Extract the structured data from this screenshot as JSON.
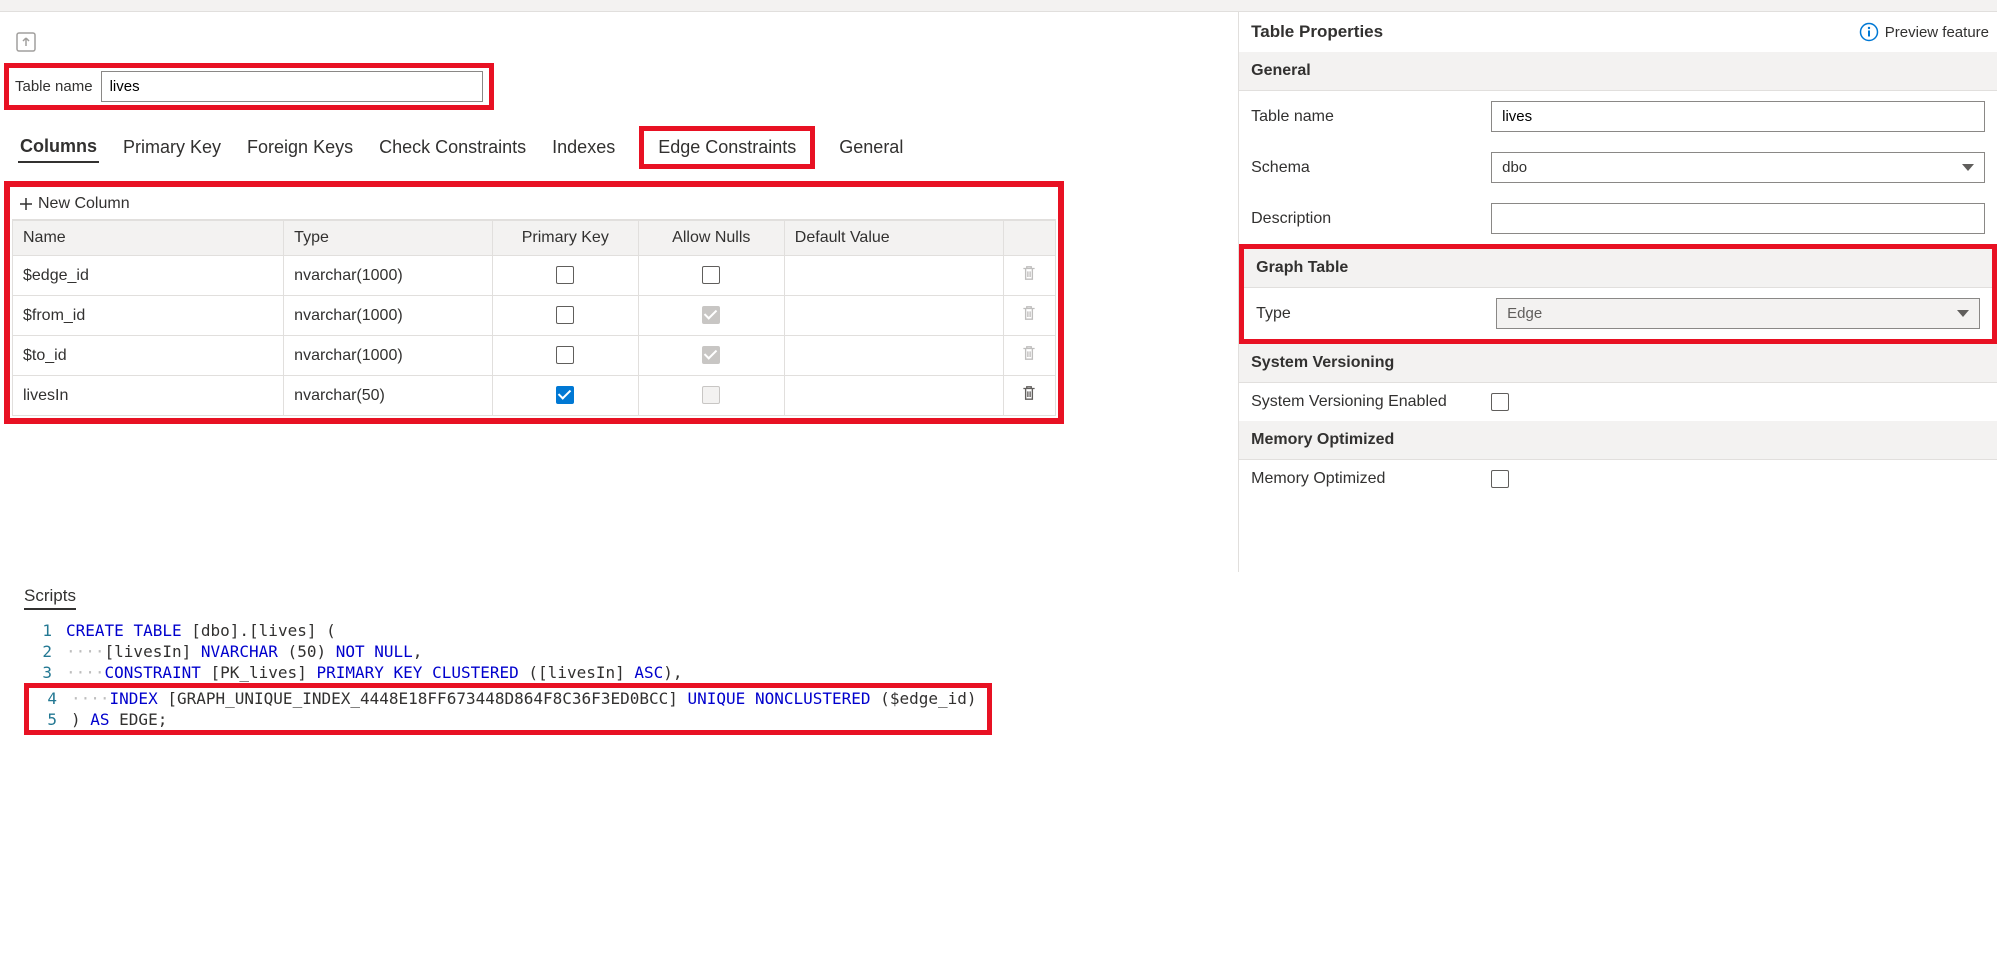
{
  "preview_feature_label": "Preview feature",
  "table_name": {
    "label": "Table name",
    "value": "lives"
  },
  "tabs": {
    "columns": "Columns",
    "primary_key": "Primary Key",
    "foreign_keys": "Foreign Keys",
    "check_constraints": "Check Constraints",
    "indexes": "Indexes",
    "edge_constraints": "Edge Constraints",
    "general": "General"
  },
  "new_column_label": "New Column",
  "column_headers": {
    "name": "Name",
    "type": "Type",
    "pk": "Primary Key",
    "nulls": "Allow Nulls",
    "default": "Default Value"
  },
  "columns": [
    {
      "name": "$edge_id",
      "type": "nvarchar(1000)",
      "pk": false,
      "nulls": "unchecked",
      "default": "",
      "trash_disabled": true
    },
    {
      "name": "$from_id",
      "type": "nvarchar(1000)",
      "pk": false,
      "nulls": "disabled-checked",
      "default": "",
      "trash_disabled": true
    },
    {
      "name": "$to_id",
      "type": "nvarchar(1000)",
      "pk": false,
      "nulls": "disabled-checked",
      "default": "",
      "trash_disabled": true
    },
    {
      "name": "livesIn",
      "type": "nvarchar(50)",
      "pk": true,
      "nulls": "disabled",
      "default": "",
      "trash_disabled": false
    }
  ],
  "properties": {
    "title": "Table Properties",
    "general": "General",
    "table_name_label": "Table name",
    "table_name_value": "lives",
    "schema_label": "Schema",
    "schema_value": "dbo",
    "description_label": "Description",
    "description_value": "",
    "graph_table": "Graph Table",
    "type_label": "Type",
    "type_value": "Edge",
    "system_versioning": "System Versioning",
    "system_versioning_enabled_label": "System Versioning Enabled",
    "memory_optimized": "Memory Optimized",
    "memory_optimized_label": "Memory Optimized"
  },
  "scripts": {
    "title": "Scripts",
    "lines": [
      {
        "n": "1",
        "pre": "",
        "tokens": [
          [
            "kw",
            "CREATE"
          ],
          [
            "punct",
            " "
          ],
          [
            "kw",
            "TABLE"
          ],
          [
            "punct",
            " [dbo].[lives] ("
          ]
        ]
      },
      {
        "n": "2",
        "pre": "····",
        "tokens": [
          [
            "punct",
            "[livesIn] "
          ],
          [
            "kw",
            "NVARCHAR"
          ],
          [
            "punct",
            " ("
          ],
          [
            "punct",
            "50"
          ],
          [
            "punct",
            ") "
          ],
          [
            "kw",
            "NOT"
          ],
          [
            "punct",
            " "
          ],
          [
            "kw",
            "NULL"
          ],
          [
            "punct",
            ","
          ]
        ]
      },
      {
        "n": "3",
        "pre": "····",
        "tokens": [
          [
            "kw",
            "CONSTRAINT"
          ],
          [
            "punct",
            " [PK_lives] "
          ],
          [
            "kw",
            "PRIMARY"
          ],
          [
            "punct",
            " "
          ],
          [
            "kw",
            "KEY"
          ],
          [
            "punct",
            " "
          ],
          [
            "kw",
            "CLUSTERED"
          ],
          [
            "punct",
            " ([livesIn] "
          ],
          [
            "kw",
            "ASC"
          ],
          [
            "punct",
            "),"
          ]
        ]
      },
      {
        "n": "4",
        "pre": "····",
        "tokens": [
          [
            "kw",
            "INDEX"
          ],
          [
            "punct",
            " [GRAPH_UNIQUE_INDEX_4448E18FF673448D864F8C36F3ED0BCC] "
          ],
          [
            "kw",
            "UNIQUE"
          ],
          [
            "punct",
            " "
          ],
          [
            "kw",
            "NONCLUSTERED"
          ],
          [
            "punct",
            " ($edge_id)"
          ]
        ]
      },
      {
        "n": "5",
        "pre": "",
        "tokens": [
          [
            "punct",
            ") "
          ],
          [
            "kw",
            "AS"
          ],
          [
            "punct",
            " EDGE;"
          ]
        ]
      }
    ]
  }
}
